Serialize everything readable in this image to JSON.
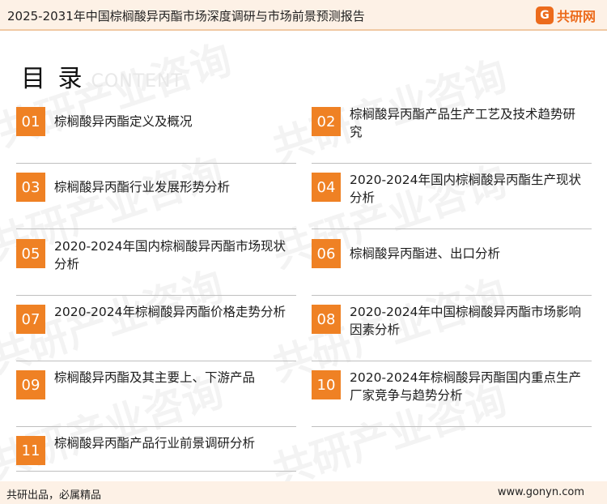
{
  "header": {
    "title": "2025-2031年中国棕榈酸异丙酯市场深度调研与市场前景预测报告"
  },
  "logo": {
    "mark": "G",
    "text": "共研网"
  },
  "watermark": {
    "text": "共研产业咨询"
  },
  "toc": {
    "title": "目 录",
    "subtitle": "CONTENT",
    "items": [
      {
        "num": "01",
        "label": "棕榈酸异丙酯定义及概况"
      },
      {
        "num": "02",
        "label": "棕榈酸异丙酯产品生产工艺及技术趋势研究"
      },
      {
        "num": "03",
        "label": "棕榈酸异丙酯行业发展形势分析"
      },
      {
        "num": "04",
        "label": "2020-2024年国内棕榈酸异丙酯生产现状分析"
      },
      {
        "num": "05",
        "label": "2020-2024年国内棕榈酸异丙酯市场现状分析"
      },
      {
        "num": "06",
        "label": "棕榈酸异丙酯进、出口分析"
      },
      {
        "num": "07",
        "label": "2020-2024年棕榈酸异丙酯价格走势分析"
      },
      {
        "num": "08",
        "label": "2020-2024年中国棕榈酸异丙酯市场影响因素分析"
      },
      {
        "num": "09",
        "label": "棕榈酸异丙酯及其主要上、下游产品"
      },
      {
        "num": "10",
        "label": "2020-2024年棕榈酸异丙酯国内重点生产厂家竞争与趋势分析"
      },
      {
        "num": "11",
        "label": "棕榈酸异丙酯产品行业前景调研分析"
      }
    ]
  },
  "footer": {
    "left": "共研出品，必属精品",
    "right": "www.gonyn.com"
  },
  "colors": {
    "accent": "#ef8124",
    "header_bg": "#fdf1e6",
    "logo": "#ec6b1c"
  }
}
